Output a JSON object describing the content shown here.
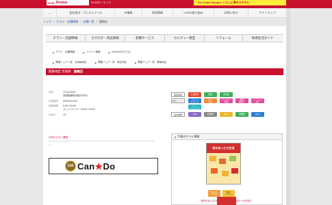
{
  "header": {
    "brand": "DCM",
    "logo": "Homac",
    "subtitle": "DCMホーマック",
    "slogan": "Do Create Mystyle くらしに夢をカタチに"
  },
  "global_nav": [
    {
      "label": "⌂",
      "icon": "home-icon"
    },
    {
      "label": "会社案内・プレスリリース"
    },
    {
      "label": "IR情報"
    },
    {
      "label": "採用情報"
    },
    {
      "label": "CSRの取り組み"
    },
    {
      "label": "お問い合せ"
    },
    {
      "label": "サイトマップ"
    }
  ],
  "breadcrumb": [
    "トップ",
    "チラシ・店舗情報",
    "店舗一覧",
    "鹿嶋店"
  ],
  "content_nav": [
    "チラシ・店舗情報",
    "カタログ・商品情報",
    "各種サービス",
    "カルチャー教室",
    "リフォーム",
    "快適生活ガイド"
  ],
  "sub_nav_1": [
    "チラシ・店舗情報",
    "イベント情報",
    "HODAKA(ホダカ)"
  ],
  "sub_nav_2": [
    "開催フェア一覧　北海道地区",
    "開催フェア一覧　東北地区",
    "開催フェア一覧　関東地区"
  ],
  "shop": {
    "region": "関東地区 茨城県",
    "name": "鹿嶋店",
    "info": [
      {
        "label": "住所",
        "value": "〒314-0031\n茨城県鹿嶋市宮中2002"
      },
      {
        "label": "代表番号",
        "value": "0299-84-5111"
      },
      {
        "label": "営業時間",
        "value": "9:30～20:00\nペットコーナー 10:00～19:00"
      },
      {
        "label": "定休日",
        "value": "1/1"
      }
    ],
    "contact_label": "お店からのご連絡",
    "contact_value": "―"
  },
  "cando": {
    "badge": "100",
    "text_a": "Can",
    "star": "★",
    "text_b": "Do"
  },
  "services": [
    {
      "label": "取扱情報",
      "tags": [
        {
          "text": "灯油販売",
          "color": "#e7432c"
        },
        {
          "text": "園芸",
          "color": "#3dae5b"
        },
        {
          "text": "資材館",
          "color": "#3dae5b"
        }
      ]
    },
    {
      "label": "専門コーナー",
      "tags": [
        {
          "text": "ペット\nショップ",
          "color": "#2e7fd3"
        },
        {
          "text": "カラー\n調合",
          "color": "#f0883a"
        },
        {
          "text": "スペアキー\n作製",
          "color": "#e04a9a"
        },
        {
          "text": "網戸\n張替え",
          "color": "#e04a9a"
        },
        {
          "text": "インテリア\n加工",
          "color": "#e04a9a"
        }
      ]
    },
    {
      "label": "",
      "tags": [
        {
          "text": "ペット\nトリミング",
          "color": "#22b5c2"
        }
      ]
    },
    {
      "label": "店内設備",
      "tags": [
        {
          "text": "ATM",
          "color": "#8a6ac8"
        },
        {
          "text": "駐車場",
          "color": "#888888"
        },
        {
          "text": "AED",
          "color": "#e7b72c"
        },
        {
          "text": "喫煙所",
          "color": "#3dae5b"
        },
        {
          "text": "Wi-Fi",
          "color": "#2e7fd3"
        }
      ]
    }
  ],
  "flyer": {
    "heading": "今週のチラシ情報",
    "image_text": "秋のあったか生活",
    "digital_btn": "デジタル\nチラシ",
    "pdf_btn": "PDF\nチラシ",
    "caption": "秋冬のあったか生活応援（10月26日～11月9日）"
  },
  "colors": {
    "brand_red": "#c8102e",
    "slogan_yellow": "#ffef3a"
  }
}
